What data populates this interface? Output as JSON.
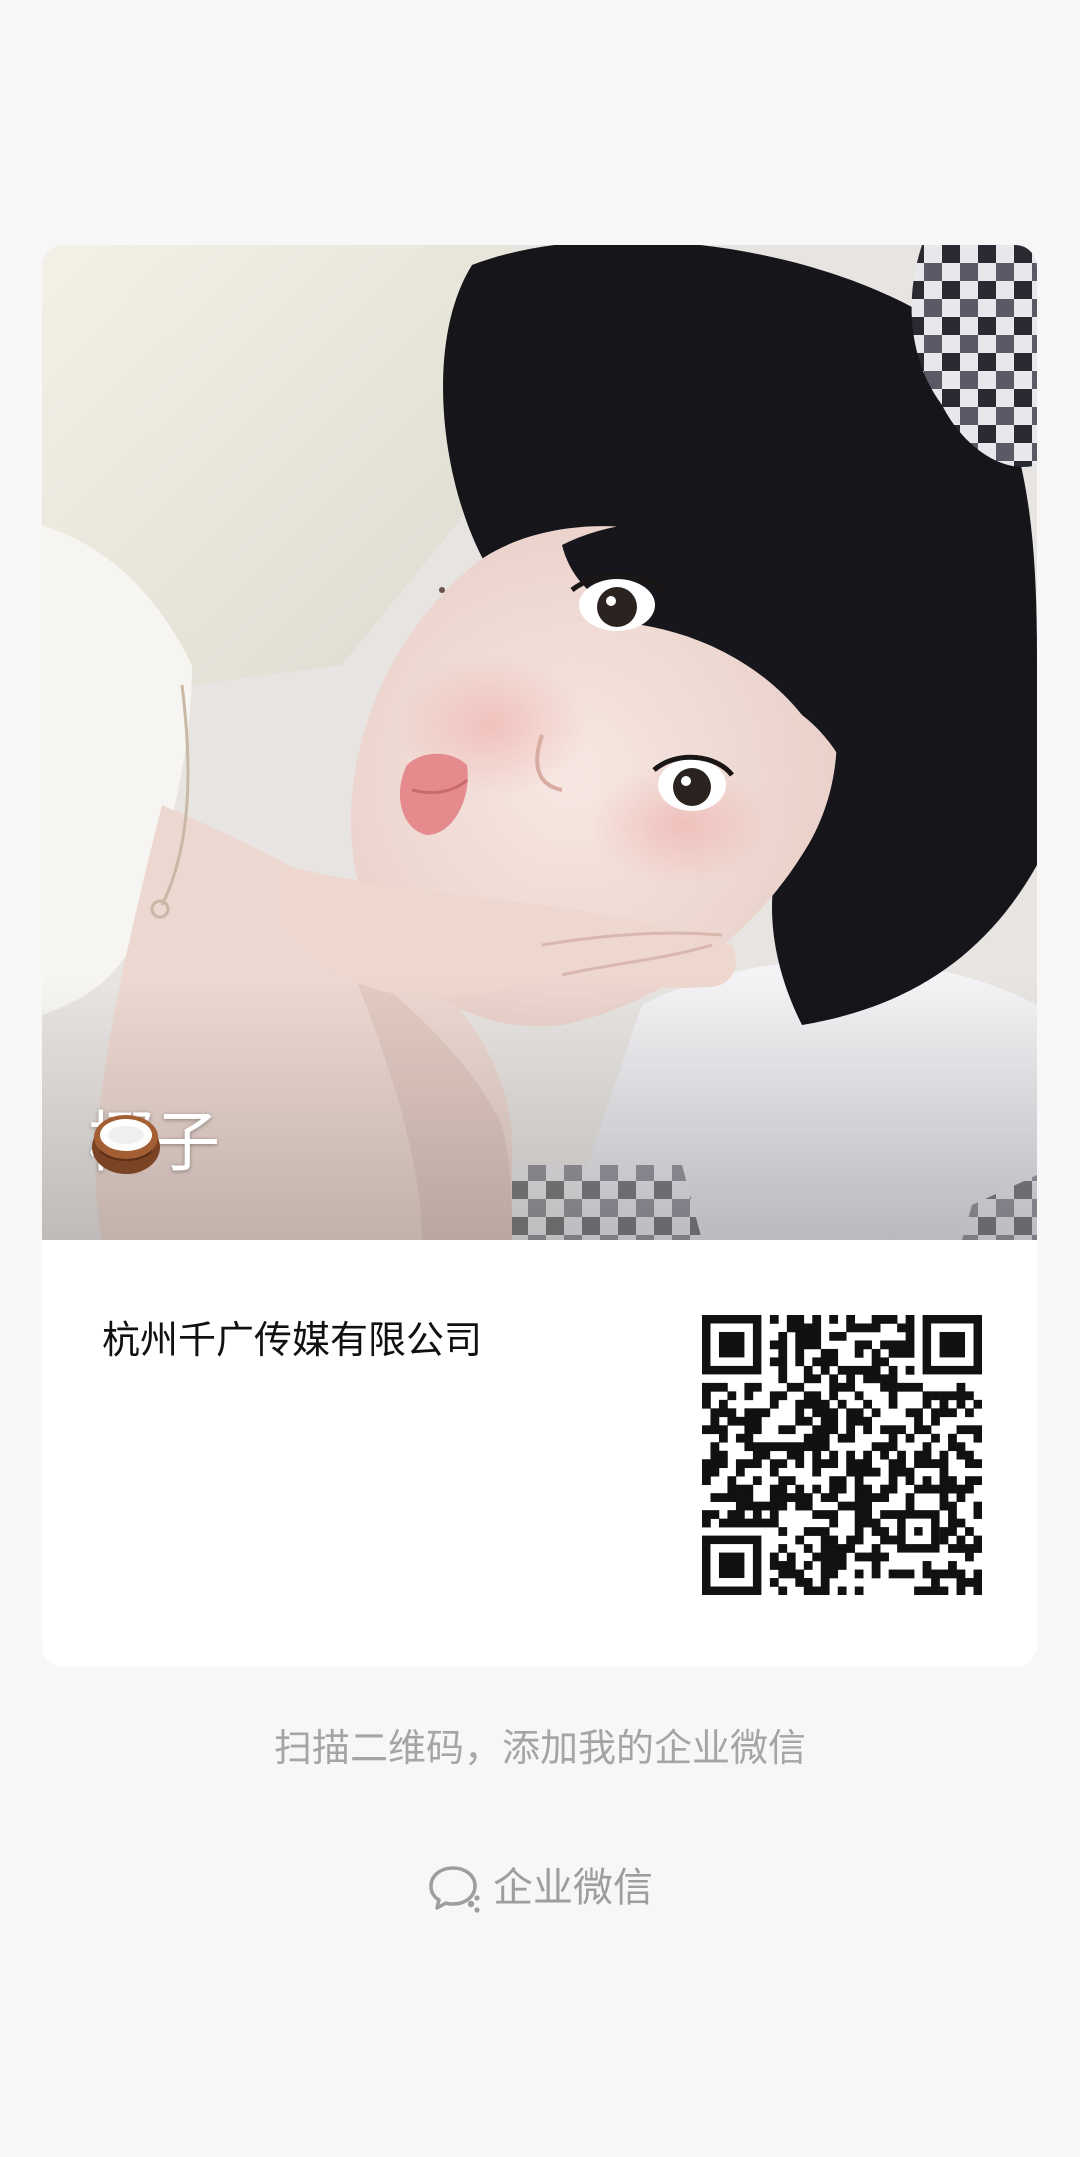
{
  "card": {
    "photo": {
      "caption": "椰子",
      "caption_emoji": "coconut-icon"
    },
    "company_name": "杭州千广传媒有限公司",
    "qr_code": "wecom-qr-code"
  },
  "hint_text": "扫描二维码，添加我的企业微信",
  "brand": {
    "icon": "wecom-logo-icon",
    "label": "企业微信"
  },
  "colors": {
    "background": "#f7f7f7",
    "card": "#ffffff",
    "hint": "#a5a5a5",
    "brand": "#9e9e9e"
  }
}
